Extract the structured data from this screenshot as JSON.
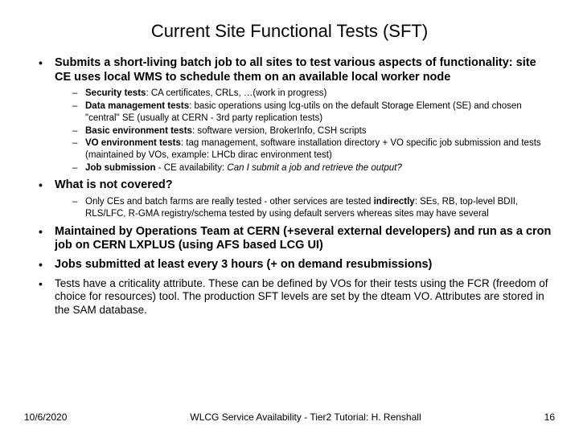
{
  "title": "Current Site Functional Tests (SFT)",
  "bullets": {
    "b1": "Submits a short-living batch job to all sites to test various aspects of functionality: site CE uses local WMS to schedule them on an available local worker node",
    "b1s": {
      "s1_b": "Security tests",
      "s1_r": ": CA certificates, CRLs, …(work in progress)",
      "s2_b": "Data management tests",
      "s2_r": ": basic operations using lcg-utils on the default Storage Element (SE) and chosen \"central\" SE (usually at CERN - 3rd party replication tests)",
      "s3_b": "Basic environment tests",
      "s3_r": ": software version, BrokerInfo, CSH scripts",
      "s4_b": "VO environment tests",
      "s4_r": ": tag management, software installation directory + VO specific job submission and tests (maintained by VOs, example: LHCb dirac environment test)",
      "s5_b": "Job submission",
      "s5_r1": " - CE availability: ",
      "s5_i": "Can I submit a job and retrieve the output?"
    },
    "b2": "What is not covered?",
    "b2s": {
      "s1a": "Only CEs and batch farms are really tested - other services are tested ",
      "s1b": "indirectly",
      "s1c": ": SEs, RB, top-level BDII, RLS/LFC, R-GMA registry/schema tested by using default servers whereas sites may have several"
    },
    "b3": "Maintained by Operations Team at CERN (+several external developers) and run as a cron job on CERN LXPLUS (using AFS based LCG UI)",
    "b4": "Jobs submitted at least every 3 hours (+ on demand resubmissions)",
    "b5": "Tests have a criticality attribute. These can be defined by VOs for their tests using the FCR (freedom of choice for resources) tool. The production SFT levels are set by the dteam VO. Attributes are stored in the SAM database."
  },
  "footer": {
    "date": "10/6/2020",
    "center": "WLCG Service Availability - Tier2 Tutorial: H. Renshall",
    "page": "16"
  }
}
